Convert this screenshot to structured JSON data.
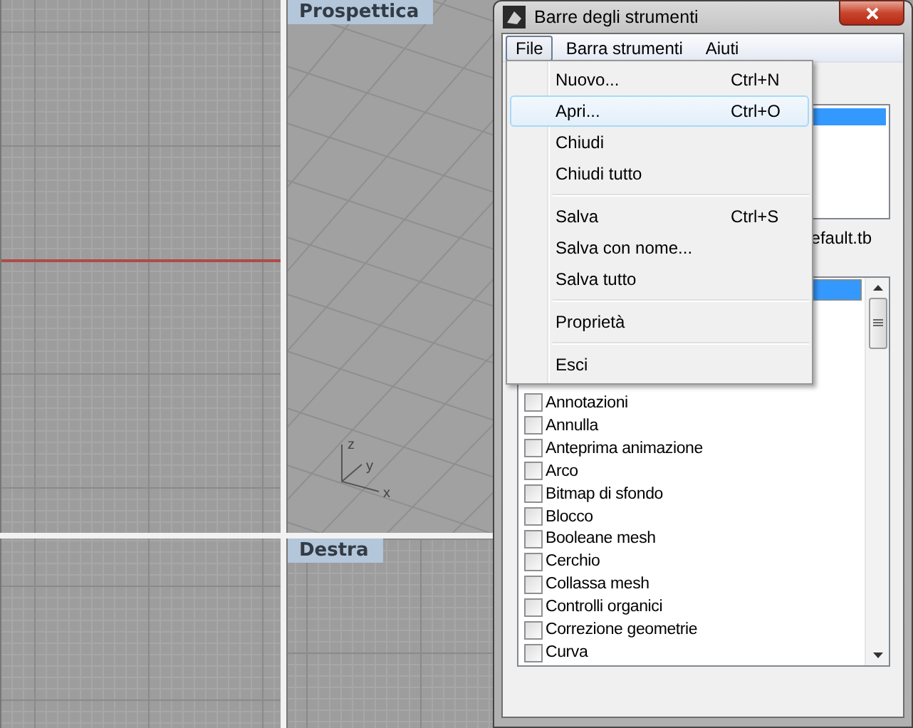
{
  "viewports": [
    {
      "kind": "plan",
      "red_axis": true
    },
    {
      "kind": "perspective",
      "label": "Prospettica",
      "axes": [
        "z",
        "y",
        "x"
      ]
    },
    {
      "kind": "plan"
    },
    {
      "kind": "plan",
      "label": "Destra"
    }
  ],
  "dialog": {
    "title": "Barre degli strumenti",
    "menu_bar": [
      {
        "label": "File",
        "selected": true
      },
      {
        "label": "Barra strumenti",
        "selected": false
      },
      {
        "label": "Aiuti",
        "selected": false
      }
    ],
    "file_menu": [
      {
        "kind": "item",
        "label": "Nuovo...",
        "shortcut": "Ctrl+N",
        "highlighted": false
      },
      {
        "kind": "item",
        "label": "Apri...",
        "shortcut": "Ctrl+O",
        "highlighted": true
      },
      {
        "kind": "item",
        "label": "Chiudi",
        "highlighted": false
      },
      {
        "kind": "item",
        "label": "Chiudi tutto",
        "highlighted": false
      },
      {
        "kind": "separator"
      },
      {
        "kind": "item",
        "label": "Salva",
        "shortcut": "Ctrl+S",
        "highlighted": false
      },
      {
        "kind": "item",
        "label": "Salva con nome...",
        "highlighted": false
      },
      {
        "kind": "item",
        "label": "Salva tutto",
        "highlighted": false
      },
      {
        "kind": "separator"
      },
      {
        "kind": "item",
        "label": "Proprietà",
        "highlighted": false
      },
      {
        "kind": "separator"
      },
      {
        "kind": "item",
        "label": "Esci",
        "highlighted": false
      }
    ],
    "file_path": "efault.tb",
    "toolbars": [
      {
        "label": "Annotazioni",
        "checked": false
      },
      {
        "label": "Annulla",
        "checked": false
      },
      {
        "label": "Anteprima animazione",
        "checked": false
      },
      {
        "label": "Arco",
        "checked": false
      },
      {
        "label": "Bitmap di sfondo",
        "checked": false
      },
      {
        "label": "Blocco",
        "checked": false
      },
      {
        "label": "Booleane mesh",
        "checked": false
      },
      {
        "label": "Cerchio",
        "checked": false
      },
      {
        "label": "Collassa mesh",
        "checked": false
      },
      {
        "label": "Controlli organici",
        "checked": false
      },
      {
        "label": "Correzione geometrie",
        "checked": false
      },
      {
        "label": "Curva",
        "checked": false
      }
    ]
  }
}
